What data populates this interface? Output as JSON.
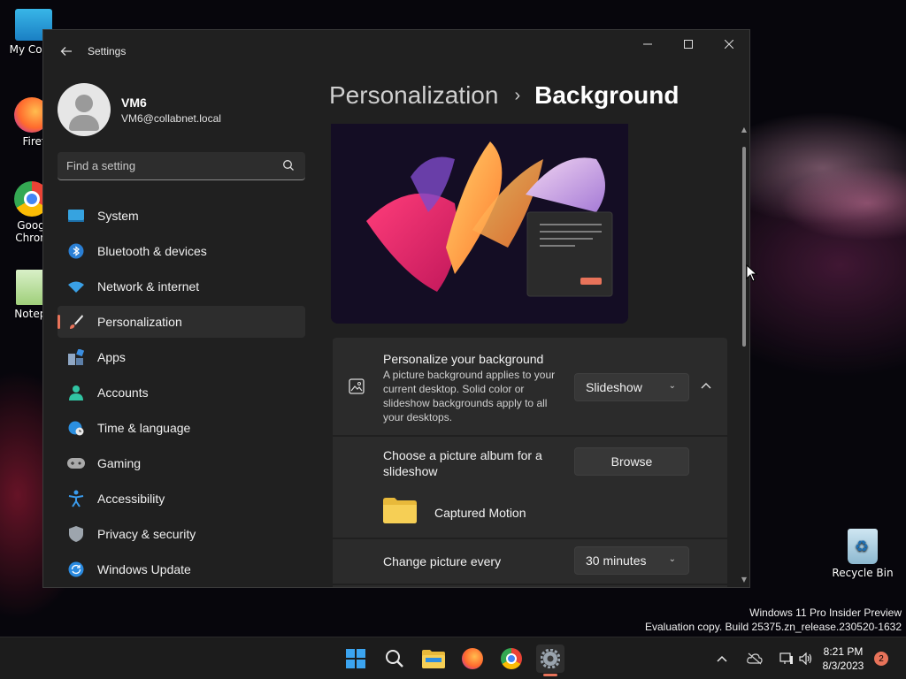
{
  "desktop": {
    "icons": [
      {
        "label": "My Com"
      },
      {
        "label": "Firefo"
      },
      {
        "label": "Goog Chron"
      },
      {
        "label": "Notepa"
      }
    ],
    "recycle_bin": "Recycle Bin"
  },
  "window": {
    "title": "Settings",
    "controls": {
      "minimize": "—",
      "maximize": "☐",
      "close": "✕"
    }
  },
  "profile": {
    "name": "VM6",
    "email": "VM6@collabnet.local"
  },
  "search": {
    "placeholder": "Find a setting"
  },
  "sidebar": {
    "items": [
      {
        "label": "System",
        "icon": "monitor-icon"
      },
      {
        "label": "Bluetooth & devices",
        "icon": "bluetooth-icon"
      },
      {
        "label": "Network & internet",
        "icon": "wifi-icon"
      },
      {
        "label": "Personalization",
        "icon": "brush-icon",
        "active": true
      },
      {
        "label": "Apps",
        "icon": "apps-icon"
      },
      {
        "label": "Accounts",
        "icon": "person-icon"
      },
      {
        "label": "Time & language",
        "icon": "globe-clock-icon"
      },
      {
        "label": "Gaming",
        "icon": "gamepad-icon"
      },
      {
        "label": "Accessibility",
        "icon": "accessibility-icon"
      },
      {
        "label": "Privacy & security",
        "icon": "shield-icon"
      },
      {
        "label": "Windows Update",
        "icon": "update-icon"
      }
    ]
  },
  "content": {
    "breadcrumb": {
      "parent": "Personalization",
      "separator": "›",
      "current": "Background"
    },
    "personalize": {
      "title": "Personalize your background",
      "description": "A picture background applies to your current desktop. Solid color or slideshow backgrounds apply to all your desktops.",
      "selected": "Slideshow"
    },
    "album": {
      "title_line1": "Choose a picture album for a",
      "title_line2": "slideshow",
      "browse_label": "Browse",
      "folder_name": "Captured Motion"
    },
    "interval": {
      "label": "Change picture every",
      "selected": "30 minutes"
    }
  },
  "watermark": {
    "line1": "Windows 11 Pro Insider Preview",
    "line2": "Evaluation copy. Build 25375.zn_release.230520-1632"
  },
  "taskbar": {
    "time": "8:21 PM",
    "date": "8/3/2023",
    "notifications": "2"
  },
  "colors": {
    "accent": "#e8735a",
    "window_bg": "#202020",
    "card_bg": "#2b2b2b"
  }
}
